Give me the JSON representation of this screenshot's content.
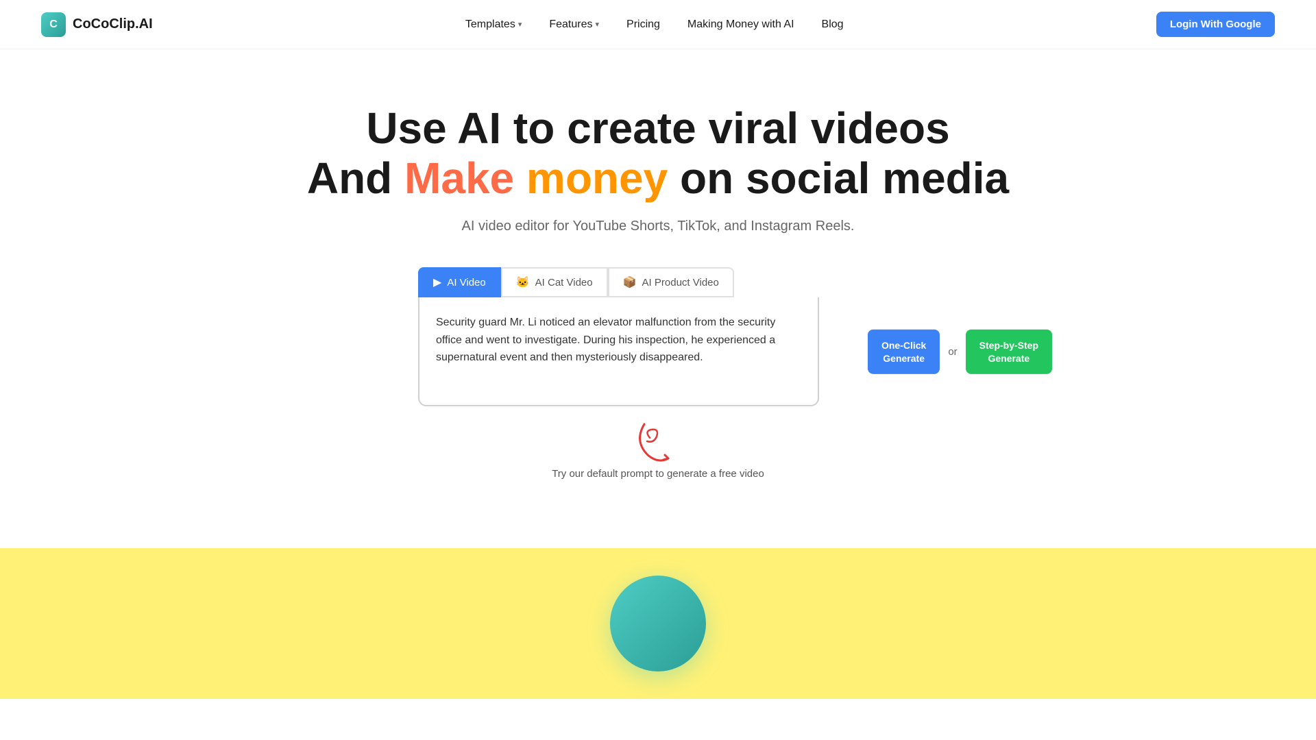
{
  "logo": {
    "icon_letter": "C",
    "text": "CoCoClip.AI"
  },
  "nav": {
    "items": [
      {
        "label": "Templates",
        "has_chevron": true,
        "id": "templates"
      },
      {
        "label": "Features",
        "has_chevron": true,
        "id": "features"
      },
      {
        "label": "Pricing",
        "has_chevron": false,
        "id": "pricing"
      },
      {
        "label": "Making Money with AI",
        "has_chevron": false,
        "id": "making-money"
      },
      {
        "label": "Blog",
        "has_chevron": false,
        "id": "blog"
      }
    ],
    "login_label": "Login With Google"
  },
  "hero": {
    "line1": "Use AI to create viral videos",
    "line2_prefix": "And ",
    "line2_make": "Make",
    "line2_money": " money",
    "line2_suffix": " on social media",
    "subtitle": "AI video editor for YouTube Shorts, TikTok, and Instagram Reels."
  },
  "tabs": [
    {
      "label": "AI Video",
      "icon": "▶",
      "active": true
    },
    {
      "label": "AI Cat Video",
      "icon": "🐱",
      "active": false
    },
    {
      "label": "AI Product Video",
      "icon": "📦",
      "active": false
    }
  ],
  "editor": {
    "placeholder_text": "Security guard Mr. Li noticed an elevator malfunction from the security office and went to investigate. During his inspection, he experienced a supernatural event and then mysteriously disappeared.",
    "one_click_label": "One-Click\nGenerate",
    "or_text": "or",
    "step_label": "Step-by-Step\nGenerate",
    "hint_text": "Try our default prompt to generate a free video"
  }
}
